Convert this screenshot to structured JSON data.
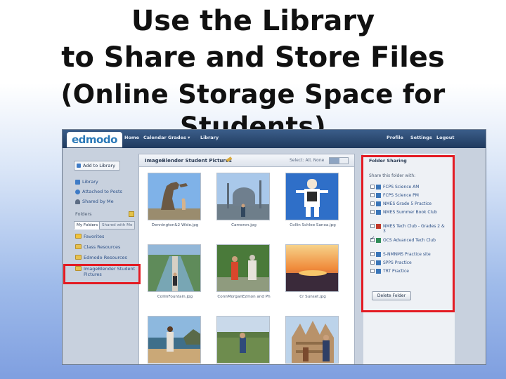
{
  "slide": {
    "title_line1": "Use the Library",
    "title_line2": "to Share and Store Files",
    "title_line3": "(Online Storage Space for Students)"
  },
  "app": {
    "logo": "edmodo",
    "nav": [
      "Home",
      "Calendar",
      "Grades ▾",
      "Library"
    ],
    "nav_right": [
      "Profile",
      "Settings",
      "Logout"
    ]
  },
  "sidebar": {
    "add_to_library": "Add to Library",
    "links": [
      {
        "label": "Library",
        "icon": "library-icon",
        "color": "#3e7bc6"
      },
      {
        "label": "Attached to Posts",
        "icon": "speech-bubble-icon",
        "color": "#3e7bc6"
      },
      {
        "label": "Shared by Me",
        "icon": "user-icon",
        "color": "#5d6d84"
      }
    ],
    "folders_heading": "Folders",
    "folder_tabs": [
      "My Folders",
      "Shared with Me"
    ],
    "folders": [
      "Favorites",
      "Class Resources",
      "Edmodo Resources",
      "ImageBlender Student Pictures"
    ]
  },
  "main": {
    "title": "ImageBlender Student Pictures",
    "select_all": "Select: All, None",
    "images": [
      {
        "caption": "Dennington&2 Wide.jpg"
      },
      {
        "caption": "Cameron.jpg"
      },
      {
        "caption": "Collin Schlee Sanoa.jpg"
      },
      {
        "caption": "CollinFountain.jpg"
      },
      {
        "caption": "ConnMorganEzmon and Ph"
      },
      {
        "caption": "Cr Sunset.jpg"
      },
      {
        "caption": ""
      },
      {
        "caption": ""
      },
      {
        "caption": ""
      }
    ]
  },
  "sharing": {
    "heading": "Folder Sharing",
    "subheading": "Share this folder with:",
    "groups": [
      {
        "label": "FCPS Science AM",
        "checked": false,
        "color": "#3a75b8"
      },
      {
        "label": "FCPS Science PM",
        "checked": false,
        "color": "#3a75b8"
      },
      {
        "label": "NMES Grade 5 Practice",
        "checked": false,
        "color": "#3a75b8"
      },
      {
        "label": "NMES Summer Book Club",
        "checked": false,
        "color": "#3a75b8"
      },
      {
        "label": "NMES Tech Club - Grades 2 & 3",
        "checked": false,
        "color": "#c0392b"
      },
      {
        "label": "OCS Advanced Tech Club",
        "checked": true,
        "color": "#2e8b57"
      },
      {
        "label": "S-NMNMS Practice site",
        "checked": false,
        "color": "#3a75b8"
      },
      {
        "label": "SPPS Practice",
        "checked": false,
        "color": "#3a75b8"
      },
      {
        "label": "TRT Practice",
        "checked": false,
        "color": "#3a75b8"
      }
    ],
    "delete_button": "Delete Folder"
  },
  "colors": {
    "topbar": "#1f3a5e",
    "link": "#2b4f86",
    "highlight": "#e31b23"
  }
}
